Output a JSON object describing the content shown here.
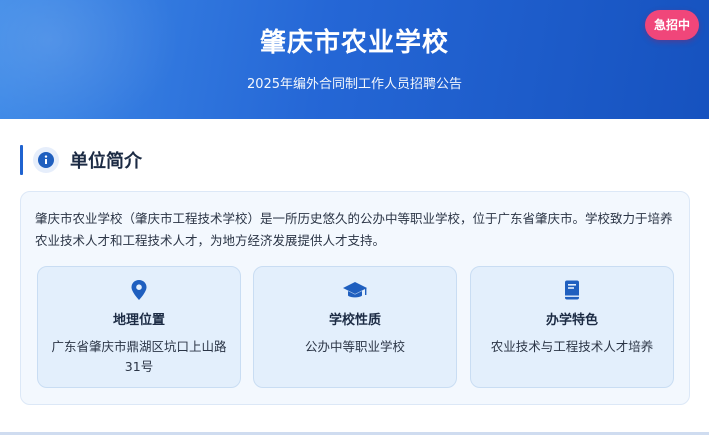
{
  "header": {
    "title": "肇庆市农业学校",
    "subtitle": "2025年编外合同制工作人员招聘公告",
    "badge": "急招中"
  },
  "section": {
    "title": "单位简介",
    "icon": "info-icon",
    "intro": "肇庆市农业学校（肇庆市工程技术学校）是一所历史悠久的公办中等职业学校，位于广东省肇庆市。学校致力于培养农业技术人才和工程技术人才，为地方经济发展提供人才支持。"
  },
  "cards": [
    {
      "icon": "location-pin-icon",
      "title": "地理位置",
      "value": "广东省肇庆市鼎湖区坑口上山路31号"
    },
    {
      "icon": "graduation-cap-icon",
      "title": "学校性质",
      "value": "公办中等职业学校"
    },
    {
      "icon": "book-icon",
      "title": "办学特色",
      "value": "农业技术与工程技术人才培养"
    }
  ],
  "colors": {
    "header_gradient_start": "#3f8be8",
    "header_gradient_end": "#1652bf",
    "badge": "#f0467a",
    "accent": "#1f63d0",
    "icon_blue": "#1f5fbf"
  }
}
